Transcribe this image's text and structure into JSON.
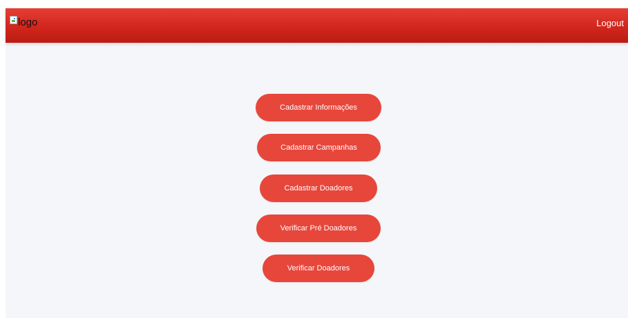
{
  "header": {
    "logo_alt": "logo",
    "logout_label": "Logout"
  },
  "menu": {
    "buttons": [
      {
        "label": "Cadastrar Informações"
      },
      {
        "label": "Cadastrar Campanhas"
      },
      {
        "label": "Cadastrar Doadores"
      },
      {
        "label": "Verificar Pré Doadores"
      },
      {
        "label": "Verificar Doadores"
      }
    ]
  },
  "colors": {
    "header_red": "#d1261d",
    "button_red": "#e7463b",
    "background": "#f4f6f9"
  }
}
